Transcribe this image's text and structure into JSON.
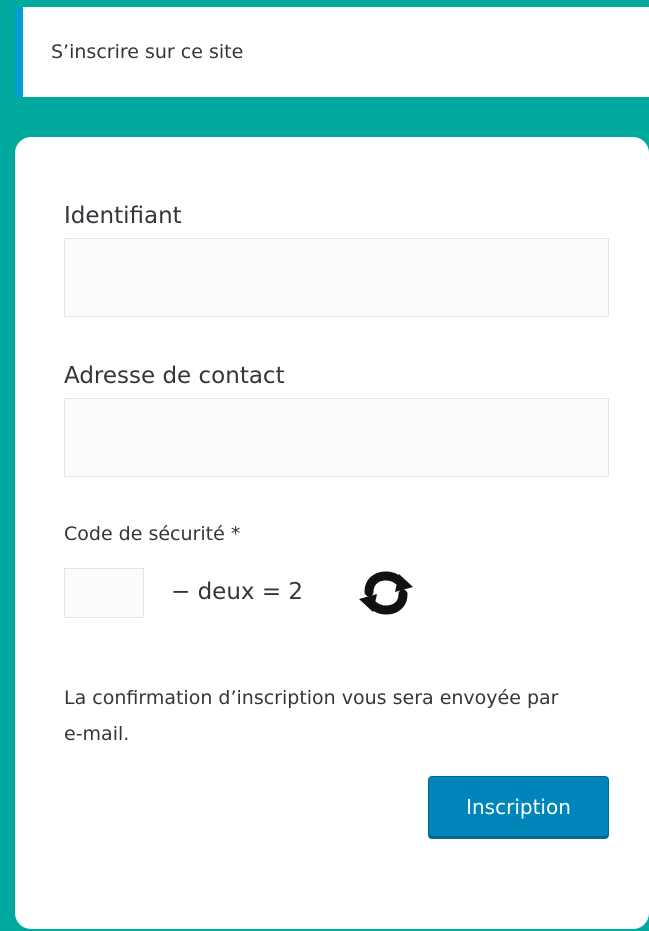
{
  "notice": {
    "text": "S’inscrire sur ce site"
  },
  "form": {
    "username_label": "Identifiant",
    "username_value": "",
    "email_label": "Adresse de contact",
    "email_value": "",
    "captcha_label": "Code de sécurité *",
    "captcha_value": "",
    "captcha_expression": "− deux = 2",
    "message": "La confirmation d’inscription vous sera envoyée par e-mail.",
    "submit_label": "Inscription"
  },
  "icons": {
    "refresh": "refresh-icon"
  },
  "colors": {
    "page_background": "#00a99d",
    "notice_accent": "#00a0d2",
    "button_background": "#0085ba",
    "button_text": "#ffffff"
  }
}
